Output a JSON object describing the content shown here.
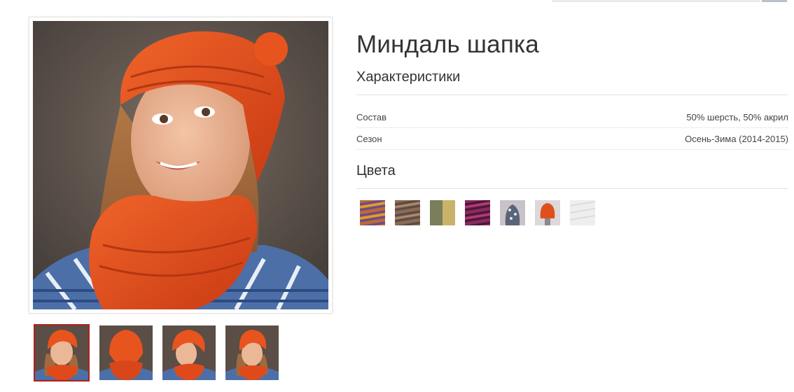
{
  "product": {
    "title": "Миндаль шапка"
  },
  "characteristics": {
    "heading": "Характеристики",
    "rows": [
      {
        "label": "Состав",
        "value": "50% шерсть, 50% акрил"
      },
      {
        "label": "Сезон",
        "value": "Осень-Зима (2014-2015)"
      }
    ]
  },
  "colors": {
    "heading": "Цвета",
    "swatches": [
      {
        "name": "multicolor-orange-purple",
        "color": "#b96a3a"
      },
      {
        "name": "brown-melange",
        "color": "#8a6a55"
      },
      {
        "name": "olive-mustard",
        "color": "#b8a45c"
      },
      {
        "name": "berry-purple",
        "color": "#8a2a5e"
      },
      {
        "name": "grey-blue-hat",
        "color": "#6c7688"
      },
      {
        "name": "orange-hat",
        "color": "#e0501d"
      },
      {
        "name": "white",
        "color": "#eeeeee"
      }
    ]
  },
  "gallery": {
    "selected_index": 0,
    "thumbnail_count": 4,
    "accent_color": "#b0201b"
  }
}
